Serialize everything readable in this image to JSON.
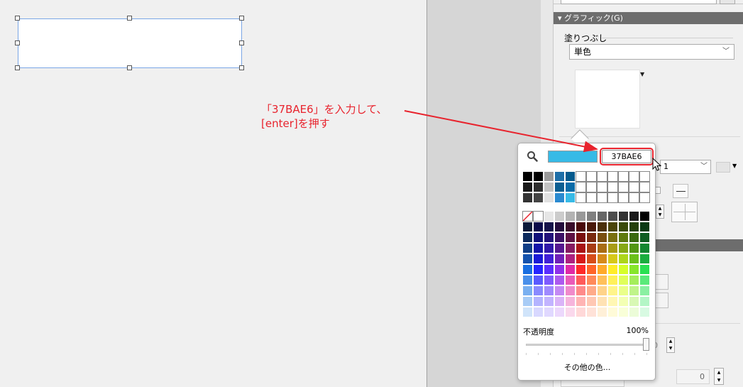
{
  "panel": {
    "section_graphic": "▾ グラフィック(G)",
    "fill_label": "塗りつぶし",
    "fill_mode": "単色",
    "line_weight": "1",
    "value_zero": "0",
    "value_zero_small": "0"
  },
  "color_popup": {
    "hex_value": "37BAE6",
    "current_color": "#37BAE6",
    "opacity_label": "不透明度",
    "opacity_value": "100%",
    "more_colors": "その他の色..."
  },
  "annotation": {
    "line1": "「37BAE6」を入力して、",
    "line2": "[enter]を押す",
    "color": "#E8232D"
  },
  "palette": {
    "top_rows": [
      [
        "#000000",
        "#000000",
        "#9a9a9a",
        "#1e6fa8",
        "#045a8d",
        "#ffffff",
        "#ffffff",
        "#ffffff",
        "#ffffff",
        "#ffffff",
        "#ffffff",
        "#ffffff"
      ],
      [
        "#1a1a1a",
        "#2d2d2d",
        "#c2c2c2",
        "#0d5f92",
        "#0b6ca8",
        "#ffffff",
        "#ffffff",
        "#ffffff",
        "#ffffff",
        "#ffffff",
        "#ffffff",
        "#ffffff"
      ],
      [
        "#333333",
        "#444444",
        "#e0e0e0",
        "#2a8ad0",
        "#37bae6",
        "#ffffff",
        "#ffffff",
        "#ffffff",
        "#ffffff",
        "#ffffff",
        "#ffffff",
        "#ffffff"
      ]
    ],
    "main_rows": [
      [
        "none",
        "#ffffff",
        "#e6e6e6",
        "#cccccc",
        "#b3b3b3",
        "#999999",
        "#808080",
        "#666666",
        "#4d4d4d",
        "#333333",
        "#1a1a1a",
        "#000000"
      ],
      [
        "#0a1a3a",
        "#0a0a4a",
        "#14124a",
        "#240d3d",
        "#3a0d2a",
        "#4a0a0a",
        "#4a1a0a",
        "#4a300a",
        "#4a450a",
        "#3a4a0a",
        "#24400a",
        "#0a3a14"
      ],
      [
        "#0d2b5e",
        "#10107a",
        "#22127a",
        "#3c1266",
        "#5e1244",
        "#7a1010",
        "#7a2a10",
        "#7a4e10",
        "#7a7010",
        "#5e7a10",
        "#3a6a10",
        "#105e22"
      ],
      [
        "#103e86",
        "#1414a8",
        "#3018a8",
        "#561890",
        "#861a62",
        "#a81414",
        "#a83c14",
        "#a86c14",
        "#a89c14",
        "#86a814",
        "#529614",
        "#148630"
      ],
      [
        "#1452ad",
        "#1a1ad6",
        "#4020d6",
        "#7020b8",
        "#ad2080",
        "#d61a1a",
        "#d64e1a",
        "#d68a1a",
        "#d6c81a",
        "#add61a",
        "#6ac01a",
        "#1aad3e"
      ],
      [
        "#1a6fe0",
        "#2626ff",
        "#5a2eff",
        "#9030ea",
        "#e02aa6",
        "#ff2a2a",
        "#ff662a",
        "#ffaa2a",
        "#ffec2a",
        "#d6ff2a",
        "#86e62a",
        "#2ae052"
      ],
      [
        "#4a90ea",
        "#5a5aff",
        "#7e5aff",
        "#ac5aef",
        "#ea5ab8",
        "#ff5a5a",
        "#ff8a5a",
        "#ffc05a",
        "#fff05a",
        "#e0ff5a",
        "#a4ee5a",
        "#5aea7a"
      ],
      [
        "#7ab0f0",
        "#8a8aff",
        "#a08aff",
        "#c48af4",
        "#f08acb",
        "#ff8a8a",
        "#ffab8a",
        "#ffd38a",
        "#fff48a",
        "#eaff8a",
        "#c0f48a",
        "#8af0a2"
      ],
      [
        "#a8ccf6",
        "#b4b4ff",
        "#c2b4ff",
        "#dab4f8",
        "#f6b4dc",
        "#ffb4b4",
        "#ffc8b4",
        "#ffe2b4",
        "#fff7b4",
        "#f3ffb4",
        "#d8f8b4",
        "#b4f6c6"
      ],
      [
        "#d0e4fa",
        "#d8d8ff",
        "#e0d8ff",
        "#ecd8fc",
        "#fad8ec",
        "#ffd8d8",
        "#ffe2d8",
        "#fff0d8",
        "#fffbd8",
        "#f9ffd8",
        "#ecfcd8",
        "#d8fae2"
      ]
    ]
  }
}
